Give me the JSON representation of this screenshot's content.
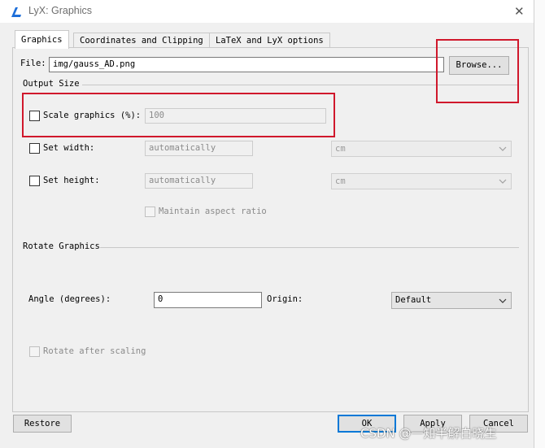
{
  "window": {
    "title": "LyX: Graphics",
    "close_glyph": "✕"
  },
  "tabs": [
    {
      "label": "Graphics"
    },
    {
      "label": "Coordinates and Clipping"
    },
    {
      "label": "LaTeX and LyX options"
    }
  ],
  "file": {
    "label": "File:",
    "value": "img/gauss_AD.png",
    "browse_label": "Browse..."
  },
  "output_size": {
    "section_label": "Output Size",
    "scale": {
      "label": "Scale graphics (%):",
      "value": "100",
      "checked": false
    },
    "width": {
      "label": "Set width:",
      "value": "automatically",
      "unit": "cm",
      "checked": false
    },
    "height": {
      "label": "Set height:",
      "value": "automatically",
      "unit": "cm",
      "checked": false
    },
    "aspect": {
      "label": "Maintain aspect ratio",
      "checked": false
    }
  },
  "rotate": {
    "section_label": "Rotate Graphics",
    "angle_label": "Angle (degrees):",
    "angle_value": "0",
    "origin_label": "Origin:",
    "origin_value": "Default",
    "after_scaling_label": "Rotate after scaling"
  },
  "buttons": {
    "restore": "Restore",
    "ok": "OK",
    "apply": "Apply",
    "cancel": "Cancel"
  },
  "watermark": "CSDN @一知半解白晓生",
  "colors": {
    "highlight": "#d0182c",
    "focus": "#0078d7",
    "lyx_icon": "#1e6fd9"
  }
}
